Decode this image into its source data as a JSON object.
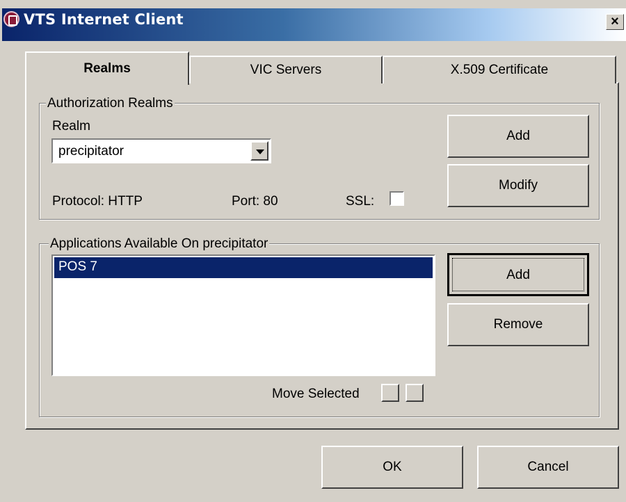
{
  "window": {
    "title": "VTS Internet Client",
    "close_label": "×"
  },
  "tabs": [
    {
      "label": "Realms",
      "active": true
    },
    {
      "label": "VIC Servers",
      "active": false
    },
    {
      "label": "X.509 Certificate",
      "active": false
    }
  ],
  "auth_group": {
    "legend": "Authorization Realms",
    "realm_label": "Realm",
    "realm_value": "precipitator",
    "protocol": "Protocol: HTTP",
    "port": "Port: 80",
    "ssl_label": "SSL:",
    "ssl_checked": false,
    "add_label": "Add",
    "modify_label": "Modify"
  },
  "apps_group": {
    "legend": "Applications Available On precipitator",
    "items": [
      {
        "label": "POS 7",
        "selected": true
      }
    ],
    "add_label": "Add",
    "remove_label": "Remove",
    "move_selected_label": "Move Selected"
  },
  "footer": {
    "ok_label": "OK",
    "cancel_label": "Cancel"
  },
  "colors": {
    "face": "#d4d0c8",
    "title_start": "#0a246a",
    "selection": "#0a246a"
  }
}
